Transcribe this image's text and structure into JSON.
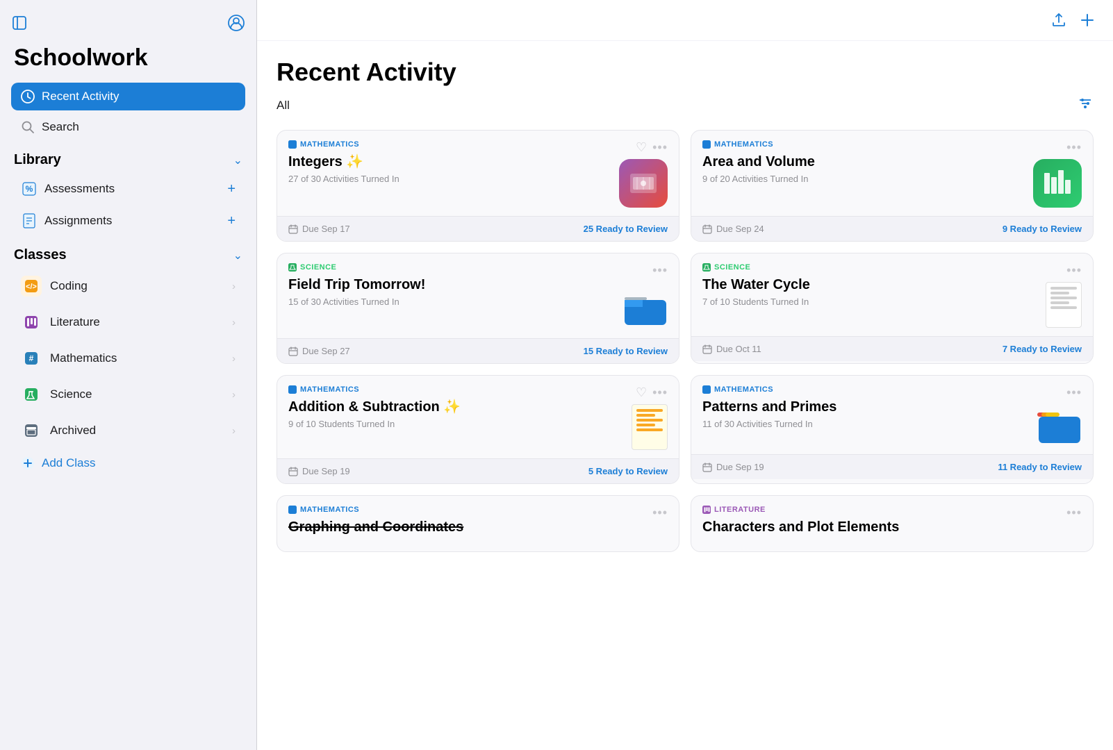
{
  "app": {
    "title": "Schoolwork"
  },
  "sidebar": {
    "nav": [
      {
        "id": "recent-activity",
        "label": "Recent Activity",
        "icon": "clock",
        "active": true
      },
      {
        "id": "search",
        "label": "Search",
        "icon": "search",
        "active": false
      }
    ],
    "library": {
      "title": "Library",
      "items": [
        {
          "id": "assessments",
          "label": "Assessments",
          "icon": "percent"
        },
        {
          "id": "assignments",
          "label": "Assignments",
          "icon": "doc"
        }
      ]
    },
    "classes": {
      "title": "Classes",
      "items": [
        {
          "id": "coding",
          "label": "Coding",
          "icon": "🟧",
          "color": "#f39c12"
        },
        {
          "id": "literature",
          "label": "Literature",
          "icon": "📊",
          "color": "#8e44ad"
        },
        {
          "id": "mathematics",
          "label": "Mathematics",
          "icon": "🔢",
          "color": "#2980b9"
        },
        {
          "id": "science",
          "label": "Science",
          "icon": "🔬",
          "color": "#27ae60"
        },
        {
          "id": "archived",
          "label": "Archived",
          "icon": "📦",
          "color": "#5d6d7e"
        }
      ],
      "addLabel": "Add Class"
    }
  },
  "main": {
    "title": "Recent Activity",
    "filter": "All",
    "cards": [
      {
        "id": "integers",
        "subject": "MATHEMATICS",
        "subjectType": "math",
        "title": "Integers ✨",
        "subtitle": "27 of 30 Activities Turned In",
        "thumbnail": "integers-app",
        "dueDate": "Due Sep 17",
        "reviewCount": "25 Ready to Review",
        "hasHeart": true
      },
      {
        "id": "area-volume",
        "subject": "MATHEMATICS",
        "subjectType": "math",
        "title": "Area and Volume",
        "subtitle": "9 of 20 Activities Turned In",
        "thumbnail": "numbers-app",
        "dueDate": "Due Sep 24",
        "reviewCount": "9 Ready to Review",
        "hasHeart": false
      },
      {
        "id": "field-trip",
        "subject": "SCIENCE",
        "subjectType": "science",
        "title": "Field Trip Tomorrow!",
        "subtitle": "15 of 30 Activities Turned In",
        "thumbnail": "folder-blue",
        "dueDate": "Due Sep 27",
        "reviewCount": "15 Ready to Review",
        "hasHeart": false
      },
      {
        "id": "water-cycle",
        "subject": "SCIENCE",
        "subjectType": "science",
        "title": "The Water Cycle",
        "subtitle": "7 of 10 Students Turned In",
        "thumbnail": "paper-doc",
        "dueDate": "Due Oct 11",
        "reviewCount": "7 Ready to Review",
        "hasHeart": false
      },
      {
        "id": "addition-subtraction",
        "subject": "MATHEMATICS",
        "subjectType": "math",
        "title": "Addition & Subtraction ✨",
        "subtitle": "9 of 10 Students Turned In",
        "thumbnail": "paper-doc2",
        "dueDate": "Due Sep 19",
        "reviewCount": "5 Ready to Review",
        "hasHeart": true
      },
      {
        "id": "patterns-primes",
        "subject": "MATHEMATICS",
        "subjectType": "math",
        "title": "Patterns and Primes",
        "subtitle": "11 of 30 Activities Turned In",
        "thumbnail": "folder-yellow",
        "dueDate": "Due Sep 19",
        "reviewCount": "11 Ready to Review",
        "hasHeart": false
      },
      {
        "id": "graphing-coordinates",
        "subject": "MATHEMATICS",
        "subjectType": "math",
        "title": "Graphing and Coordinates",
        "subtitle": "",
        "thumbnail": null,
        "dueDate": "",
        "reviewCount": "",
        "hasHeart": false,
        "titleStrike": true,
        "partial": true
      },
      {
        "id": "characters-plot",
        "subject": "LITERATURE",
        "subjectType": "literature",
        "title": "Characters and Plot Elements",
        "subtitle": "",
        "thumbnail": null,
        "dueDate": "",
        "reviewCount": "",
        "hasHeart": false,
        "partial": true
      }
    ]
  }
}
